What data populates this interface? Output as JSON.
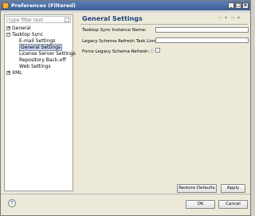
{
  "window": {
    "title": "Preferences (Filtered)"
  },
  "filter": {
    "placeholder": "type filter text"
  },
  "tree": [
    {
      "label": "General",
      "toggle": "+"
    },
    {
      "label": "Tasktop Sync",
      "toggle": "−"
    },
    {
      "label": "E-mail Settings"
    },
    {
      "label": "General Settings",
      "selected": true
    },
    {
      "label": "License Server Settings"
    },
    {
      "label": "Repository Back-off"
    },
    {
      "label": "Web Settings"
    },
    {
      "label": "XML",
      "toggle": "+"
    }
  ],
  "page": {
    "title": "General Settings",
    "instance_name_label": "Tasktop Sync Instance Name:",
    "legacy_limit_label": "Legacy Schema Refresh Task Limit:",
    "force_legacy_label": "Force Legacy Schema Refresh:",
    "info_symbol": "ⓘ",
    "instance_name_value": "",
    "legacy_limit_value": ""
  },
  "buttons": {
    "restore_defaults": "Restore Defaults",
    "apply": "Apply",
    "ok": "OK",
    "cancel": "Cancel"
  },
  "icons": {
    "back": "⇦",
    "forward": "⇨",
    "dropdown": "▾",
    "help": "?"
  }
}
